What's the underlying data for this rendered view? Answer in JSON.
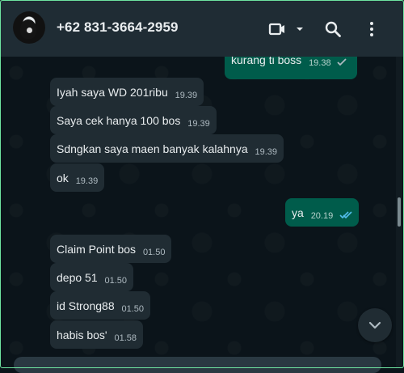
{
  "header": {
    "contact_name": "+62 831-3664-2959",
    "icons": [
      "avatar",
      "video-call-icon",
      "chevron-down-icon",
      "search-icon",
      "more-vertical-icon"
    ]
  },
  "messages": [
    {
      "text": "kurang ti boss",
      "time": "19.38",
      "direction": "out",
      "status": "read"
    },
    {
      "text": "Iyah saya WD 201ribu",
      "time": "19.39",
      "direction": "in"
    },
    {
      "text": "Saya cek hanya 100 bos",
      "time": "19.39",
      "direction": "in"
    },
    {
      "text": "Sdngkan saya maen banyak kalahnya",
      "time": "19.39",
      "direction": "in"
    },
    {
      "text": "ok",
      "time": "19.39",
      "direction": "in"
    },
    {
      "text": "ya",
      "time": "20.19",
      "direction": "out",
      "status": "read"
    },
    {
      "text": "Claim Point bos",
      "time": "01.50",
      "direction": "in"
    },
    {
      "text": "depo 51",
      "time": "01.50",
      "direction": "in"
    },
    {
      "text": "id Strong88",
      "time": "01.50",
      "direction": "in"
    },
    {
      "text": "habis bos'",
      "time": "01.58",
      "direction": "in"
    }
  ],
  "colors": {
    "background": "#0b141a",
    "header": "#1f2c34",
    "incoming_bubble": "#202c33",
    "outgoing_bubble": "#005c4b",
    "read_ticks": "#53bdeb"
  }
}
